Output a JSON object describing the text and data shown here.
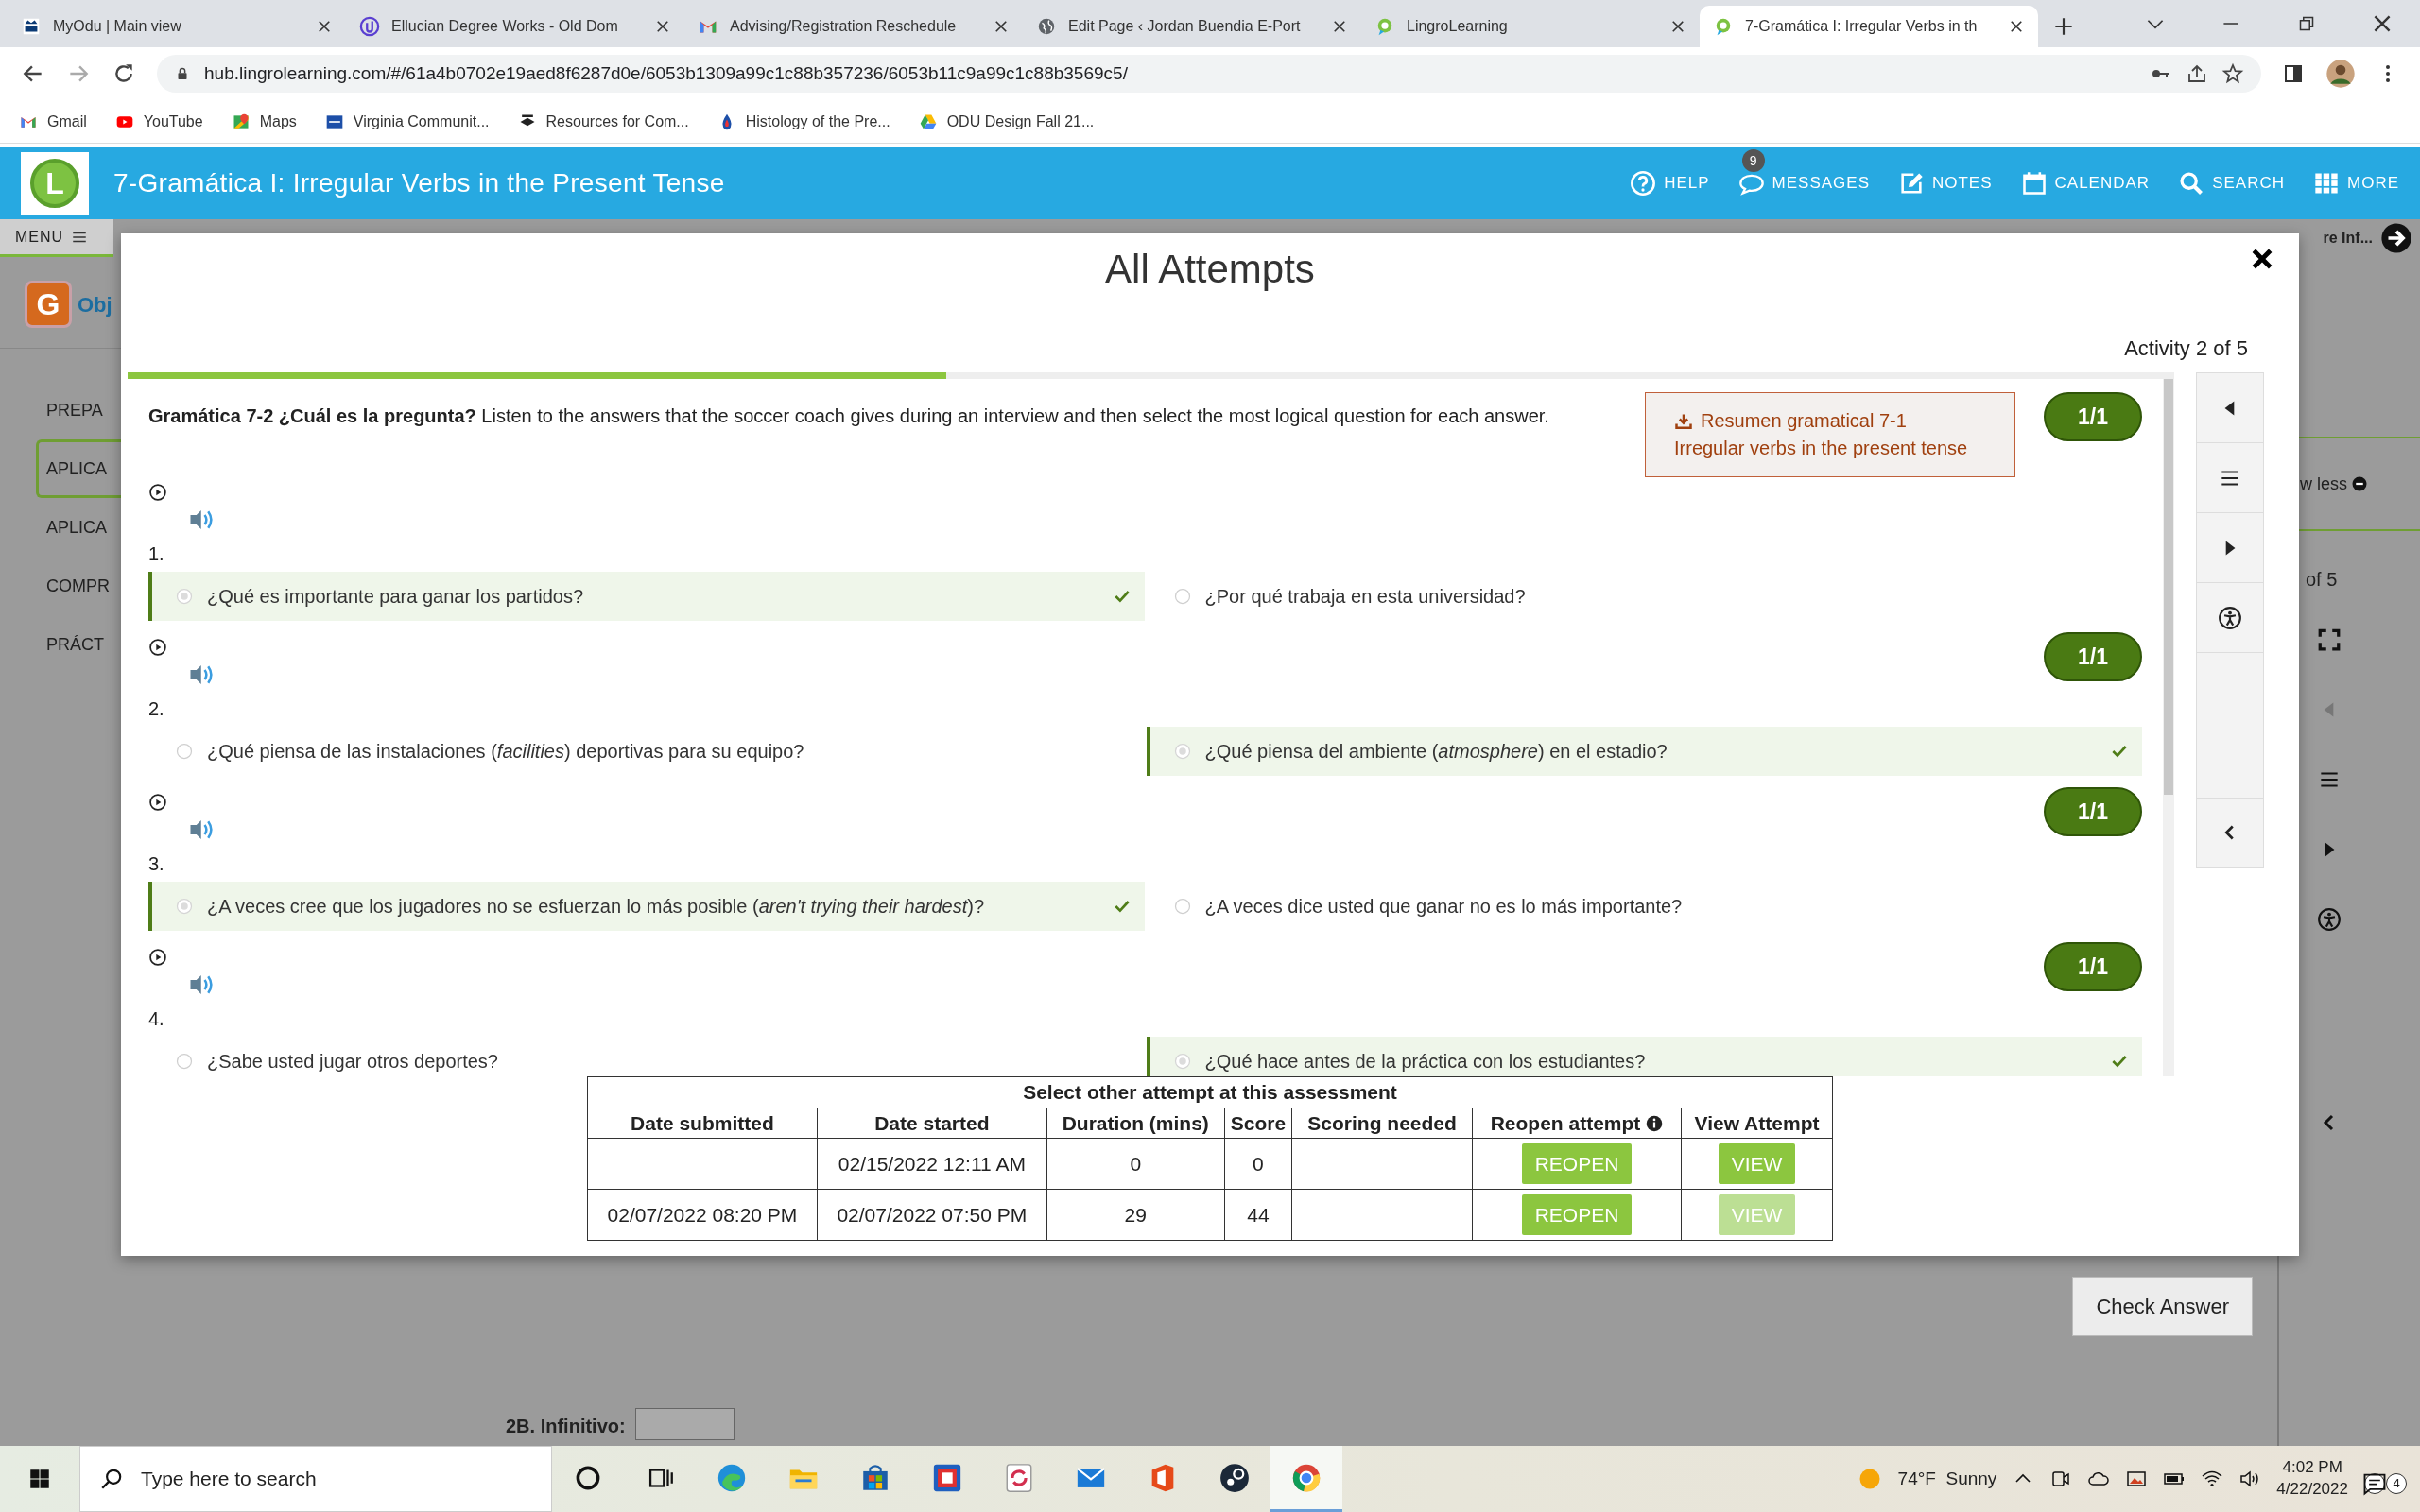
{
  "browser": {
    "tabs": [
      {
        "kind": "odu",
        "title": "MyOdu | Main view",
        "selected": false
      },
      {
        "kind": "degreeworks",
        "title": "Ellucian Degree Works - Old Dom",
        "selected": false
      },
      {
        "kind": "gmail",
        "title": "Advising/Registration Reschedule",
        "selected": false
      },
      {
        "kind": "globe",
        "title": "Edit Page ‹ Jordan Buendia E-Port",
        "selected": false
      },
      {
        "kind": "lingro",
        "title": "LingroLearning",
        "selected": false
      },
      {
        "kind": "lingro",
        "title": "7-Gramática I: Irregular Verbs in th",
        "selected": true
      }
    ],
    "address": "hub.lingrolearning.com/#/61a4b0702e19aed8f6287d0e/6053b1309a99c1c88b357236/6053b11c9a99c1c88b3569c5/",
    "bookmarks": [
      {
        "kind": "gmail",
        "label": "Gmail"
      },
      {
        "kind": "youtube",
        "label": "YouTube"
      },
      {
        "kind": "maps",
        "label": "Maps"
      },
      {
        "kind": "vccs",
        "label": "Virginia Communit..."
      },
      {
        "kind": "jkcf",
        "label": "Resources for Com..."
      },
      {
        "kind": "drop",
        "label": "Histology of the Pre..."
      },
      {
        "kind": "drive",
        "label": "ODU Design Fall 21..."
      }
    ]
  },
  "app_header": {
    "logo_letter": "L",
    "title": "7-Gramática I: Irregular Verbs in the Present Tense",
    "nav": [
      {
        "kind": "help",
        "label": "HELP"
      },
      {
        "kind": "messages",
        "label": "MESSAGES",
        "badge": "9"
      },
      {
        "kind": "notes",
        "label": "NOTES"
      },
      {
        "kind": "calendar",
        "label": "CALENDAR"
      },
      {
        "kind": "search",
        "label": "SEARCH"
      },
      {
        "kind": "more",
        "label": "MORE"
      }
    ]
  },
  "background_page": {
    "menu_label": "MENU",
    "top_right_text": "re Inf...",
    "logo_letter": "G",
    "heading": "Obj",
    "sidebar_items": [
      {
        "label": "PREPA",
        "selected": false
      },
      {
        "label": "APLICA",
        "selected": true
      },
      {
        "label": "APLICA",
        "selected": false
      },
      {
        "label": "COMPR",
        "selected": false
      },
      {
        "label": "PRÁCT",
        "selected": false
      }
    ],
    "show_less": "w less",
    "activity_counter": "of 5",
    "check_answer": "Check Answer",
    "field_label": "2B. Infinitivo:"
  },
  "modal": {
    "title": "All Attempts",
    "activity": "Activity 2 of 5",
    "progress": {
      "level": 0.4
    },
    "instructions": "**Gramática 7-2 ¿Cuál es la pregunta?** Listen to the answers that the soccer coach gives during an interview and then select the most logical question for each answer.",
    "resource": {
      "line1": "Resumen gramatical 7-1",
      "line2": "Irregular verbs in the present tense"
    },
    "questions": [
      {
        "number": "1.",
        "score": "1/1",
        "options": [
          {
            "text": "¿Qué es importante para ganar los partidos?",
            "selected": true
          },
          {
            "text": "¿Por qué trabaja en esta universidad?",
            "selected": false
          }
        ]
      },
      {
        "number": "2.",
        "score": "1/1",
        "options": [
          {
            "text": "¿Qué piensa de las instalaciones (*facilities*) deportivas para su equipo?",
            "selected": false
          },
          {
            "text": "¿Qué piensa del ambiente (*atmosphere*) en el estadio?",
            "selected": true
          }
        ]
      },
      {
        "number": "3.",
        "score": "1/1",
        "options": [
          {
            "text": "¿A veces cree que los jugadores no se esfuerzan lo más posible (*aren't trying their hardest*)?",
            "selected": true
          },
          {
            "text": "¿A veces dice usted que ganar no es lo más importante?",
            "selected": false
          }
        ]
      },
      {
        "number": "4.",
        "score": "1/1",
        "options": [
          {
            "text": "¿Sabe usted jugar otros deportes?",
            "selected": false
          },
          {
            "text": "¿Qué hace antes de la práctica con los estudiantes?",
            "selected": true
          }
        ]
      }
    ],
    "attempts_table": {
      "caption": "Select other attempt at this assessment",
      "columns": [
        "Date submitted",
        "Date started",
        "Duration (mins)",
        "Score",
        "Scoring needed",
        "Reopen  attempt",
        "View Attempt"
      ],
      "rows": [
        {
          "cells": [
            "",
            "02/15/2022 12:11 AM",
            "0",
            "0",
            ""
          ],
          "reopen": "REOPEN",
          "view": {
            "label": "VIEW",
            "disabled": false
          }
        },
        {
          "cells": [
            "02/07/2022 08:20 PM",
            "02/07/2022 07:50 PM",
            "29",
            "44",
            ""
          ],
          "reopen": "REOPEN",
          "view": {
            "label": "VIEW",
            "disabled": true
          }
        }
      ]
    }
  },
  "taskbar": {
    "search_placeholder": "Type here to search",
    "apps": [
      {
        "kind": "cortana",
        "active": false
      },
      {
        "kind": "taskview",
        "active": false
      },
      {
        "kind": "edge",
        "active": false
      },
      {
        "kind": "explorer",
        "active": false
      },
      {
        "kind": "store",
        "active": false
      },
      {
        "kind": "redapp",
        "active": false
      },
      {
        "kind": "sync",
        "active": false
      },
      {
        "kind": "mail",
        "active": false
      },
      {
        "kind": "office",
        "active": false
      },
      {
        "kind": "steam",
        "active": false
      },
      {
        "kind": "chrome",
        "active": true
      }
    ],
    "weather": "74°F  Sunny",
    "time": "4:02 PM",
    "date": "4/22/2022",
    "notifications": "4"
  }
}
